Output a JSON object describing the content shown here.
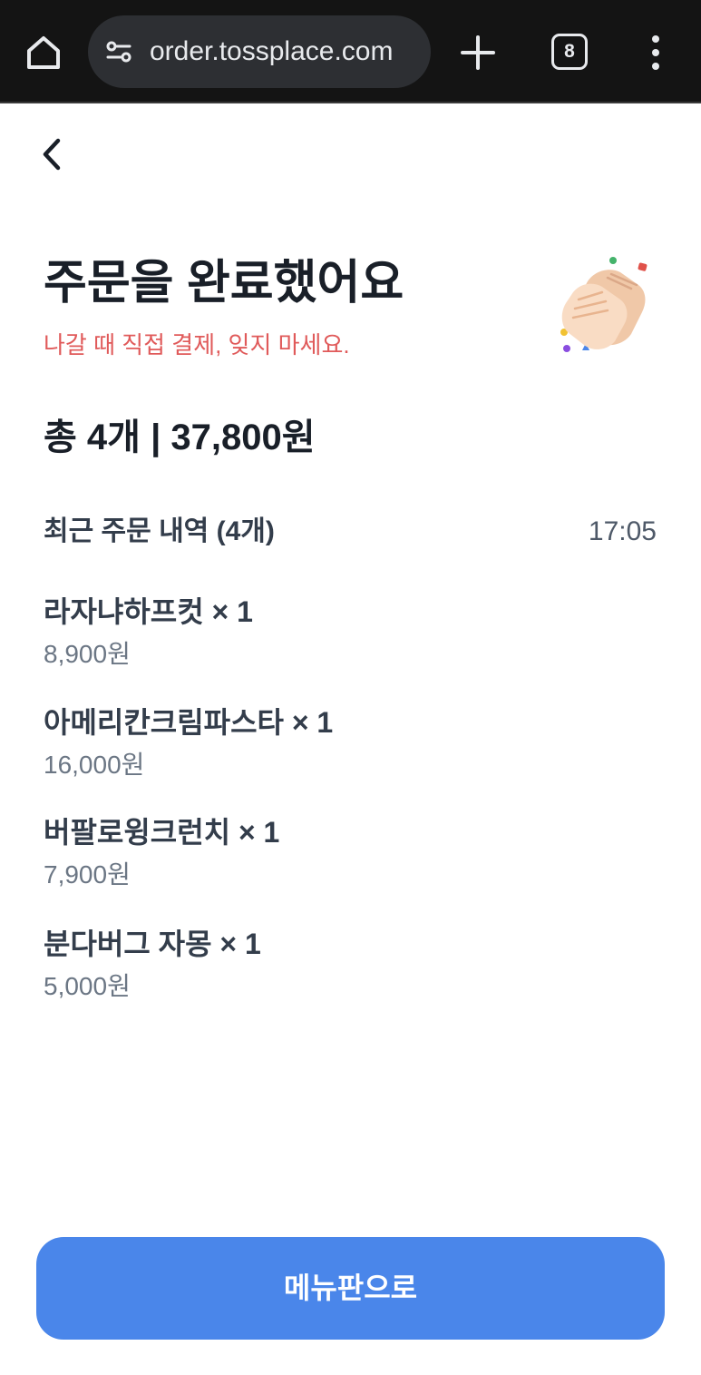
{
  "browser": {
    "url": "order.tossplace.com",
    "tab_count": "8",
    "icons": {
      "home": "home-icon",
      "site_settings": "site-settings-icon",
      "new_tab": "plus-icon",
      "menu": "more-vert-icon"
    }
  },
  "header": {
    "back_icon": "chevron-left-icon"
  },
  "confirmation": {
    "title": "주문을 완료했어요",
    "subtitle": "나갈 때 직접 결제, 잊지 마세요.",
    "illustration": "clapping-hands-icon"
  },
  "summary": {
    "total": "총 4개 | 37,800원"
  },
  "recent_orders": {
    "heading": "최근 주문 내역 (4개)",
    "time": "17:05",
    "items": [
      {
        "name": "라자냐하프컷 × 1",
        "price": "8,900원"
      },
      {
        "name": "아메리칸크림파스타 × 1",
        "price": "16,000원"
      },
      {
        "name": "버팔로윙크런치 × 1",
        "price": "7,900원"
      },
      {
        "name": "분다버그 자몽 × 1",
        "price": "5,000원"
      }
    ]
  },
  "footer": {
    "button_label": "메뉴판으로"
  },
  "colors": {
    "accent": "#4a86ea",
    "warning_text": "#e05a5a",
    "browser_bg": "#141414"
  }
}
